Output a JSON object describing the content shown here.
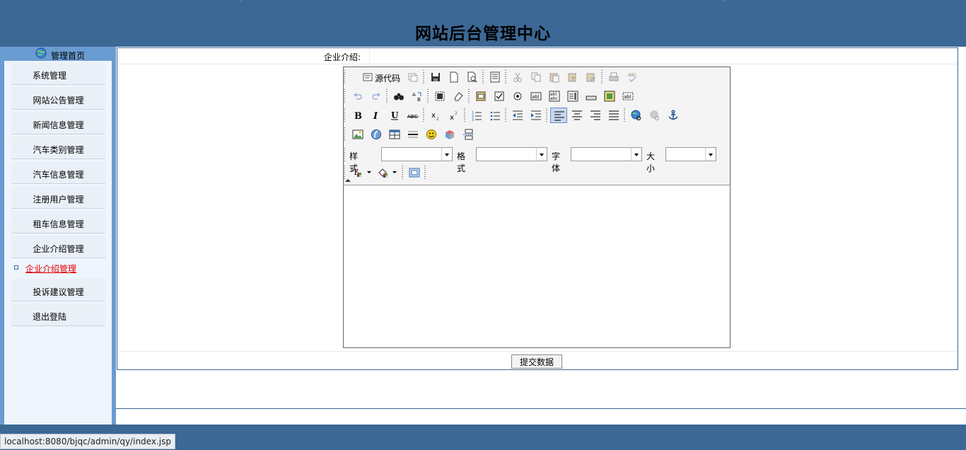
{
  "header": {
    "title": "网站后台管理中心"
  },
  "sidebar": {
    "home_label": "管理首页",
    "items": [
      {
        "label": "系统管理"
      },
      {
        "label": "网站公告管理"
      },
      {
        "label": "新闻信息管理"
      },
      {
        "label": "汽车类别管理"
      },
      {
        "label": "汽车信息管理"
      },
      {
        "label": "注册用户管理"
      },
      {
        "label": "租车信息管理"
      },
      {
        "label": "企业介绍管理"
      },
      {
        "label": "投诉建议管理"
      },
      {
        "label": "退出登陆"
      }
    ],
    "active_sub_item": "企业介绍管理"
  },
  "form": {
    "field_label": "企业介绍:",
    "submit_label": "提交数据"
  },
  "editor": {
    "source_label": "源代码",
    "style_label": "样式",
    "format_label": "格式",
    "font_label": "字体",
    "size_label": "大小",
    "content": ""
  },
  "status_bar": {
    "url": "localhost:8080/bjqc/admin/qy/index.jsp"
  },
  "colors": {
    "header_bg": "#3c6895",
    "sidebar_bg": "#6a9bd1",
    "active_link": "#e00000"
  }
}
